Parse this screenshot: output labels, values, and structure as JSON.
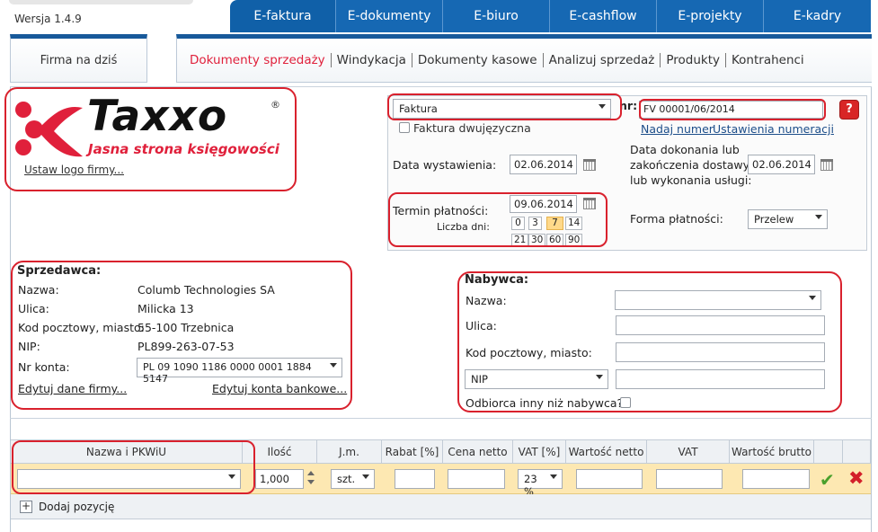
{
  "app": {
    "version": "Wersja 1.4.9"
  },
  "top_tabs": [
    {
      "label": "E-faktura",
      "w": 118
    },
    {
      "label": "E-dokumenty",
      "w": 119
    },
    {
      "label": "E-biuro",
      "w": 119
    },
    {
      "label": "E-cashflow",
      "w": 119
    },
    {
      "label": "E-projekty",
      "w": 119
    },
    {
      "label": "E-kadry",
      "w": 119
    }
  ],
  "firma": {
    "label": "Firma na dziś"
  },
  "subnav": [
    {
      "label": "Dokumenty sprzedaży",
      "active": true
    },
    {
      "label": "Windykacja"
    },
    {
      "label": "Dokumenty kasowe"
    },
    {
      "label": "Analizuj sprzedaż"
    },
    {
      "label": "Produkty"
    },
    {
      "label": "Kontrahenci"
    }
  ],
  "logo": {
    "word": "Taxxo",
    "reg": "®",
    "slogan": "Jasna strona księgowości",
    "set_logo_link": "Ustaw logo firmy...",
    "brand_color": "#e0203b"
  },
  "document": {
    "type_value": "Faktura",
    "nr_label": "nr:",
    "nr_value": "FV 00001/06/2014",
    "bilingual_label": "Faktura dwujęzyczna",
    "assign_number_link": "Nadaj numer",
    "numbering_settings_link": "Ustawienia numeracji",
    "issue_date_label": "Data wystawienia:",
    "issue_date": "02.06.2014",
    "completion_label_1": "Data dokonania lub",
    "completion_label_2": "zakończenia dostawy",
    "completion_label_3": "lub wykonania usługi:",
    "completion_date": "02.06.2014",
    "payment_term_label": "Termin płatności:",
    "payment_term_date": "09.06.2014",
    "days_label": "Liczba dni:",
    "days": [
      "0",
      "3",
      "7",
      "14",
      "21",
      "30",
      "60",
      "90"
    ],
    "days_selected": "7",
    "payment_form_label": "Forma płatności:",
    "payment_form": "Przelew",
    "help": "?"
  },
  "seller": {
    "title": "Sprzedawca:",
    "name_label": "Nazwa:",
    "name": "Columb Technologies SA",
    "street_label": "Ulica:",
    "street": "Milicka 13",
    "postal_label": "Kod pocztowy, miasto:",
    "postal": "55-100 Trzebnica",
    "nip_label": "NIP:",
    "nip": "PL899-263-07-53",
    "account_label": "Nr konta:",
    "account": "PL 09 1090 1186 0000 0001 1884 5147",
    "edit_company_link": "Edytuj dane firmy...",
    "edit_accounts_link": "Edytuj konta bankowe..."
  },
  "buyer": {
    "title": "Nabywca:",
    "name_label": "Nazwa:",
    "street_label": "Ulica:",
    "postal_label": "Kod pocztowy, miasto:",
    "nip_select": "NIP",
    "other_recipient_label": "Odbiorca inny niż nabywca?"
  },
  "table": {
    "headers": [
      "Nazwa i PKWiU",
      "Ilość",
      "J.m.",
      "Rabat [%]",
      "Cena netto",
      "VAT [%]",
      "Wartość netto",
      "VAT",
      "Wartość brutto",
      "",
      ""
    ],
    "row": {
      "qty": "1,000",
      "unit": "szt.",
      "vat": "23 %"
    },
    "add_label": "Dodaj pozycję",
    "add_icon": "+"
  },
  "icons": {
    "ok": "✔",
    "delete": "✖"
  }
}
